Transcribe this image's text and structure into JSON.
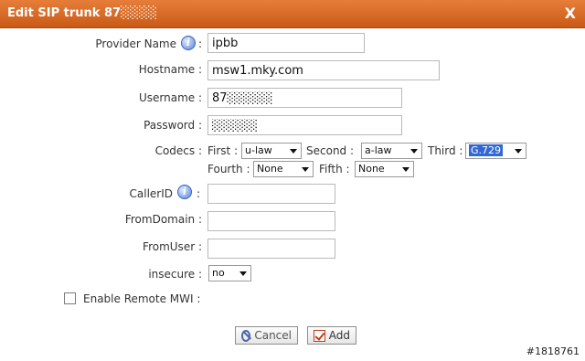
{
  "dialog": {
    "title": "Edit SIP trunk 87░░░░",
    "close": "X"
  },
  "fields": {
    "provider_name": {
      "label": "Provider Name",
      "value": "ipbb"
    },
    "hostname": {
      "label": "Hostname :",
      "value": "msw1.mky.com"
    },
    "username": {
      "label": "Username :",
      "value": "87░░░░░"
    },
    "password": {
      "label": "Password :",
      "value": "░░░░░"
    },
    "callerid": {
      "label": "CallerID",
      "value": ""
    },
    "fromdomain": {
      "label": "FromDomain :",
      "value": ""
    },
    "fromuser": {
      "label": "FromUser :",
      "value": ""
    },
    "insecure": {
      "label": "insecure :",
      "value": "no"
    },
    "remote_mwi": {
      "label": "Enable Remote MWI :",
      "checked": false
    }
  },
  "colon": ":",
  "codecs": {
    "label": "Codecs :",
    "first_label": "First :",
    "first": "u-law",
    "second_label": "Second :",
    "second": "a-law",
    "third_label": "Third :",
    "third": "G.729",
    "fourth_label": "Fourth :",
    "fourth": "None",
    "fifth_label": "Fifth :",
    "fifth": "None"
  },
  "buttons": {
    "cancel": "Cancel",
    "add": "Add"
  },
  "watermark": "#1818761",
  "colors": {
    "titlebar": "#d46a24",
    "accent": "#3168d5"
  }
}
